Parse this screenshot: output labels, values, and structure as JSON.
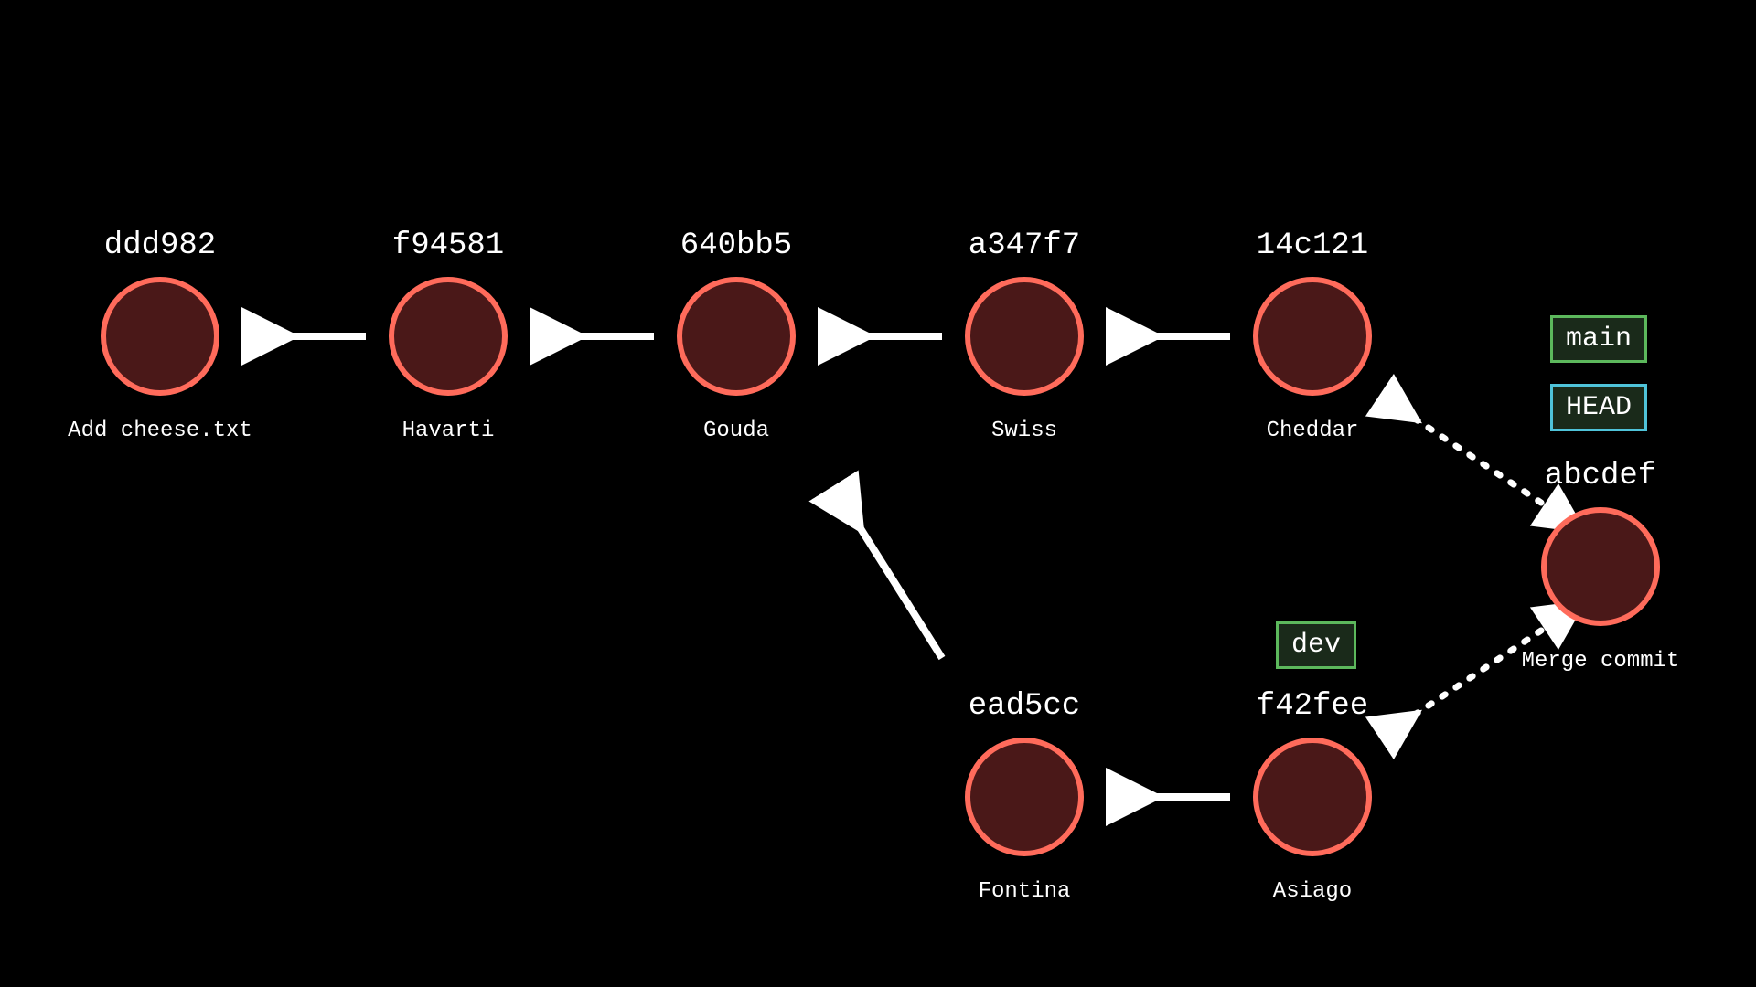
{
  "commits": {
    "c1": {
      "hash": "ddd982",
      "message": "Add cheese.txt"
    },
    "c2": {
      "hash": "f94581",
      "message": "Havarti"
    },
    "c3": {
      "hash": "640bb5",
      "message": "Gouda"
    },
    "c4": {
      "hash": "a347f7",
      "message": "Swiss"
    },
    "c5": {
      "hash": "14c121",
      "message": "Cheddar"
    },
    "c6": {
      "hash": "ead5cc",
      "message": "Fontina"
    },
    "c7": {
      "hash": "f42fee",
      "message": "Asiago"
    },
    "c8": {
      "hash": "abcdef",
      "message": "Merge commit"
    }
  },
  "branches": {
    "main": {
      "label": "main"
    },
    "head": {
      "label": "HEAD"
    },
    "dev": {
      "label": "dev"
    }
  },
  "colors": {
    "node_fill": "#4a1818",
    "node_stroke": "#ff6b5b",
    "arrow": "#ffffff",
    "branch_green": "#5cb85c",
    "branch_teal": "#4fc3d9",
    "bg": "#000000"
  },
  "diagram": {
    "description": "Git commit graph showing a main branch (ddd982 → f94581 → 640bb5 → a347f7 → 14c121), a dev branch off 640bb5 (ead5cc → f42fee), and a merge commit abcdef combining 14c121 and f42fee. HEAD and main point at the merge commit; dev points at f42fee.",
    "edges_parent_arrows": [
      [
        "c2",
        "c1"
      ],
      [
        "c3",
        "c2"
      ],
      [
        "c4",
        "c3"
      ],
      [
        "c5",
        "c4"
      ],
      [
        "c6",
        "c3"
      ],
      [
        "c7",
        "c6"
      ],
      [
        "c8",
        "c5"
      ],
      [
        "c8",
        "c7"
      ]
    ]
  }
}
